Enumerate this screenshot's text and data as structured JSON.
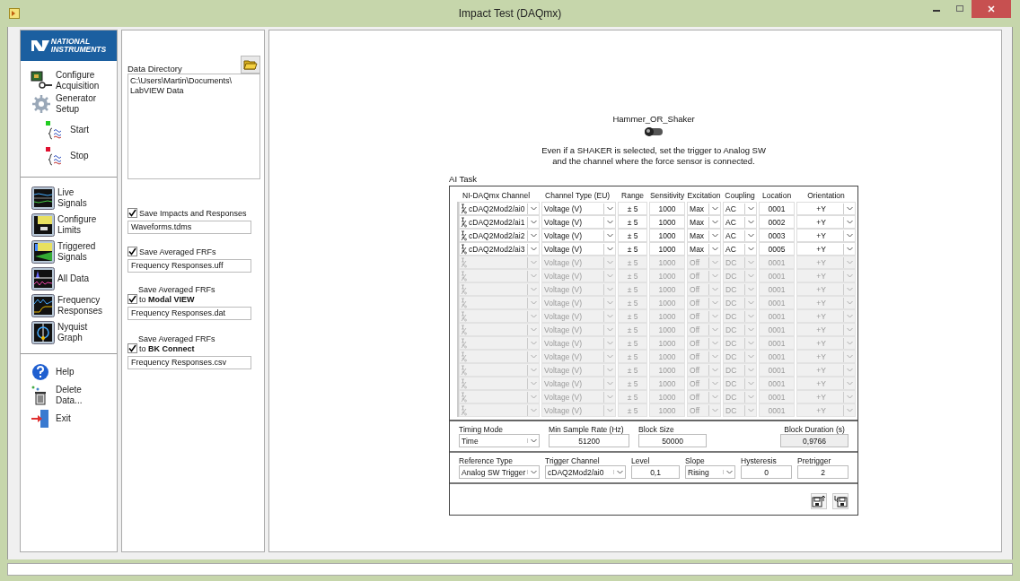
{
  "window": {
    "title": "Impact Test (DAQmx)"
  },
  "logo": {
    "lines": [
      "NATIONAL",
      "INSTRUMENTS"
    ]
  },
  "nav_groups": [
    {
      "items": [
        {
          "label": "Configure Acquisition"
        },
        {
          "label": "Generator Setup"
        },
        {
          "label": "Start"
        },
        {
          "label": "Stop"
        }
      ]
    },
    {
      "items": [
        {
          "label": "Live Signals"
        },
        {
          "label": "Configure Limits"
        },
        {
          "label": "Triggered Signals"
        },
        {
          "label": "All Data"
        },
        {
          "label": "Frequency Responses"
        },
        {
          "label": "Nyquist Graph"
        }
      ]
    },
    {
      "items": [
        {
          "label": "Help"
        },
        {
          "label": "Delete Data..."
        },
        {
          "label": "Exit"
        }
      ]
    }
  ],
  "data_directory": {
    "label": "Data Directory",
    "lines": [
      "C:\\Users\\Martin\\Documents\\",
      "LabVIEW Data"
    ]
  },
  "save_options": [
    {
      "kind": "inline",
      "label": "Save Impacts and Responses",
      "checked": true,
      "file": "Waveforms.tdms"
    },
    {
      "kind": "inline",
      "label": "Save Averaged FRFs",
      "checked": true,
      "file": "Frequency Responses.uff"
    },
    {
      "kind": "stacked",
      "caption": "Save Averaged FRFs",
      "label": "to **Modal VIEW**",
      "checked": true,
      "file": "Frequency Responses.dat"
    },
    {
      "kind": "stacked",
      "caption": "Save Averaged FRFs",
      "label": "to **BK Connect**",
      "checked": true,
      "file": "Frequency Responses.csv"
    }
  ],
  "switch": {
    "label": "Hammer_OR_Shaker",
    "on": false
  },
  "note": [
    "Even if a SHAKER is selected, set the trigger to Analog SW",
    "and the channel where the force sensor is connected."
  ],
  "ai_task": {
    "label": "AI Task",
    "columns": [
      "NI-DAQmx Channel",
      "Channel Type (EU)",
      "Range",
      "Sensitivity",
      "Excitation",
      "Coupling",
      "Location",
      "Orientation"
    ],
    "rows": [
      {
        "enabled": true,
        "channel": "cDAQ2Mod2/ai0",
        "type": "Voltage (V)",
        "range": "± 5",
        "sensitivity": "1000",
        "excitation": "Max",
        "coupling": "AC",
        "location": "0001",
        "orientation": "+Y"
      },
      {
        "enabled": true,
        "channel": "cDAQ2Mod2/ai1",
        "type": "Voltage (V)",
        "range": "± 5",
        "sensitivity": "1000",
        "excitation": "Max",
        "coupling": "AC",
        "location": "0002",
        "orientation": "+Y"
      },
      {
        "enabled": true,
        "channel": "cDAQ2Mod2/ai2",
        "type": "Voltage (V)",
        "range": "± 5",
        "sensitivity": "1000",
        "excitation": "Max",
        "coupling": "AC",
        "location": "0003",
        "orientation": "+Y"
      },
      {
        "enabled": true,
        "channel": "cDAQ2Mod2/ai3",
        "type": "Voltage (V)",
        "range": "± 5",
        "sensitivity": "1000",
        "excitation": "Max",
        "coupling": "AC",
        "location": "0005",
        "orientation": "+Y"
      },
      {
        "enabled": false,
        "type": "Voltage (V)",
        "range": "± 5",
        "sensitivity": "1000",
        "excitation": "Off",
        "coupling": "DC",
        "location": "0001",
        "orientation": "+Y"
      },
      {
        "enabled": false,
        "type": "Voltage (V)",
        "range": "± 5",
        "sensitivity": "1000",
        "excitation": "Off",
        "coupling": "DC",
        "location": "0001",
        "orientation": "+Y"
      },
      {
        "enabled": false,
        "type": "Voltage (V)",
        "range": "± 5",
        "sensitivity": "1000",
        "excitation": "Off",
        "coupling": "DC",
        "location": "0001",
        "orientation": "+Y"
      },
      {
        "enabled": false,
        "type": "Voltage (V)",
        "range": "± 5",
        "sensitivity": "1000",
        "excitation": "Off",
        "coupling": "DC",
        "location": "0001",
        "orientation": "+Y"
      },
      {
        "enabled": false,
        "type": "Voltage (V)",
        "range": "± 5",
        "sensitivity": "1000",
        "excitation": "Off",
        "coupling": "DC",
        "location": "0001",
        "orientation": "+Y"
      },
      {
        "enabled": false,
        "type": "Voltage (V)",
        "range": "± 5",
        "sensitivity": "1000",
        "excitation": "Off",
        "coupling": "DC",
        "location": "0001",
        "orientation": "+Y"
      },
      {
        "enabled": false,
        "type": "Voltage (V)",
        "range": "± 5",
        "sensitivity": "1000",
        "excitation": "Off",
        "coupling": "DC",
        "location": "0001",
        "orientation": "+Y"
      },
      {
        "enabled": false,
        "type": "Voltage (V)",
        "range": "± 5",
        "sensitivity": "1000",
        "excitation": "Off",
        "coupling": "DC",
        "location": "0001",
        "orientation": "+Y"
      },
      {
        "enabled": false,
        "type": "Voltage (V)",
        "range": "± 5",
        "sensitivity": "1000",
        "excitation": "Off",
        "coupling": "DC",
        "location": "0001",
        "orientation": "+Y"
      },
      {
        "enabled": false,
        "type": "Voltage (V)",
        "range": "± 5",
        "sensitivity": "1000",
        "excitation": "Off",
        "coupling": "DC",
        "location": "0001",
        "orientation": "+Y"
      },
      {
        "enabled": false,
        "type": "Voltage (V)",
        "range": "± 5",
        "sensitivity": "1000",
        "excitation": "Off",
        "coupling": "DC",
        "location": "0001",
        "orientation": "+Y"
      },
      {
        "enabled": false,
        "type": "Voltage (V)",
        "range": "± 5",
        "sensitivity": "1000",
        "excitation": "Off",
        "coupling": "DC",
        "location": "0001",
        "orientation": "+Y"
      }
    ]
  },
  "timing": [
    {
      "kind": "dropdown",
      "label": "Timing Mode",
      "value": "Time"
    },
    {
      "kind": "number",
      "label": "Min Sample Rate (Hz)",
      "value": "51200"
    },
    {
      "kind": "number",
      "label": "Block Size",
      "value": "50000"
    },
    {
      "kind": "indicator",
      "label": "Block Duration (s)",
      "value": "0,9766"
    }
  ],
  "trigger": [
    {
      "kind": "dropdown",
      "label": "Reference Type",
      "value": "Analog SW Trigger"
    },
    {
      "kind": "dropdown",
      "label": "Trigger Channel",
      "value": "cDAQ2Mod2/ai0"
    },
    {
      "kind": "number",
      "label": "Level",
      "value": "0,1"
    },
    {
      "kind": "dropdown",
      "label": "Slope",
      "value": "Rising"
    },
    {
      "kind": "number",
      "label": "Hysteresis",
      "value": "0"
    },
    {
      "kind": "number",
      "label": "Pretrigger",
      "value": "2"
    }
  ]
}
